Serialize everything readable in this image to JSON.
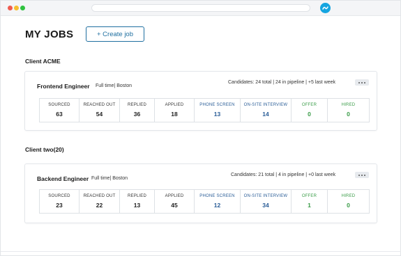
{
  "page": {
    "title": "MY JOBS",
    "create_button": "+ Create job"
  },
  "colors": {
    "accent": "#1f6fa0",
    "stage_blue": "#2a5d97",
    "stage_green": "#3a9c48"
  },
  "clients": [
    {
      "name": "Client ACME",
      "jobs": [
        {
          "title": "Frontend Engineer",
          "meta": "Full time| Boston",
          "stats": "Candidates: 24 total | 24 in pipeline | +5 last week",
          "stages": [
            {
              "label": "SOURCED",
              "count": "63",
              "color": "default"
            },
            {
              "label": "REACHED OUT",
              "count": "54",
              "color": "default"
            },
            {
              "label": "REPLIED",
              "count": "36",
              "color": "default"
            },
            {
              "label": "APPLIED",
              "count": "18",
              "color": "default"
            },
            {
              "label": "PHONE SCREEN",
              "count": "13",
              "color": "blue"
            },
            {
              "label": "ON-SITE INTERVIEW",
              "count": "14",
              "color": "blue"
            },
            {
              "label": "OFFER",
              "count": "0",
              "color": "green"
            },
            {
              "label": "HIRED",
              "count": "0",
              "color": "green"
            }
          ]
        }
      ]
    },
    {
      "name": "Client two(20)",
      "jobs": [
        {
          "title": "Backend Engineer",
          "meta": "Full time| Boston",
          "stats": "Candidates: 21 total | 4 in pipeline | +0 last week",
          "stages": [
            {
              "label": "SOURCED",
              "count": "23",
              "color": "default"
            },
            {
              "label": "REACHED OUT",
              "count": "22",
              "color": "default"
            },
            {
              "label": "REPLIED",
              "count": "13",
              "color": "default"
            },
            {
              "label": "APPLIED",
              "count": "45",
              "color": "default"
            },
            {
              "label": "PHONE SCREEN",
              "count": "12",
              "color": "blue"
            },
            {
              "label": "ON-SITE INTERVIEW",
              "count": "34",
              "color": "blue"
            },
            {
              "label": "OFFER",
              "count": "1",
              "color": "green"
            },
            {
              "label": "HIRED",
              "count": "0",
              "color": "green"
            }
          ]
        }
      ]
    }
  ]
}
